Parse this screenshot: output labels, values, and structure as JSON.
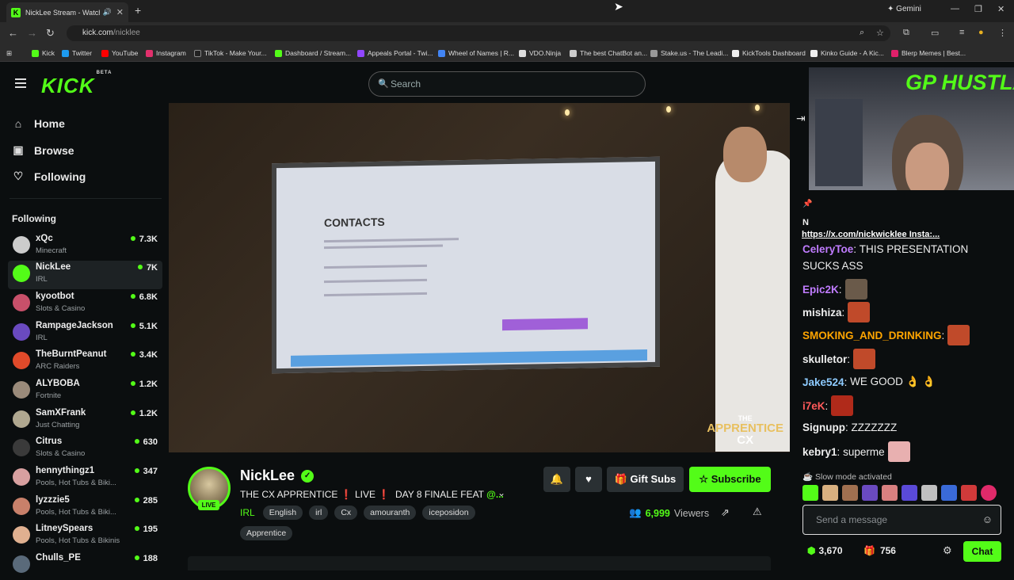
{
  "browser": {
    "tab_title": "NickLee Stream - Watch Live",
    "url_host": "kick.com",
    "url_path": "/nicklee",
    "gemini_label": "Gemini",
    "bookmarks": [
      "Kick",
      "Twitter",
      "YouTube",
      "Instagram",
      "TikTok - Make Your...",
      "Dashboard / Stream...",
      "Appeals Portal - Twi...",
      "Wheel of Names | R...",
      "VDO.Ninja",
      "The best ChatBot an...",
      "Stake.us - The Leadi...",
      "KickTools Dashboard",
      "Kinko Guide - A Kic...",
      "Blerp Memes | Best..."
    ]
  },
  "header": {
    "logo": "KICK",
    "logo_badge": "BETA",
    "search_placeholder": "Search"
  },
  "sidebar": {
    "nav": [
      {
        "label": "Home",
        "icon": "home-icon"
      },
      {
        "label": "Browse",
        "icon": "browse-icon"
      },
      {
        "label": "Following",
        "icon": "heart-icon"
      }
    ],
    "following_heading": "Following",
    "following": [
      {
        "name": "xQc",
        "category": "Minecraft",
        "viewers": "7.3K"
      },
      {
        "name": "NickLee",
        "category": "IRL",
        "viewers": "7K"
      },
      {
        "name": "kyootbot",
        "category": "Slots & Casino",
        "viewers": "6.8K"
      },
      {
        "name": "RampageJackson",
        "category": "IRL",
        "viewers": "5.1K"
      },
      {
        "name": "TheBurntPeanut",
        "category": "ARC Raiders",
        "viewers": "3.4K"
      },
      {
        "name": "ALYBOBA",
        "category": "Fortnite",
        "viewers": "1.2K"
      },
      {
        "name": "SamXFrank",
        "category": "Just Chatting",
        "viewers": "1.2K"
      },
      {
        "name": "Citrus",
        "category": "Slots & Casino",
        "viewers": "630"
      },
      {
        "name": "hennythingz1",
        "category": "Pools, Hot Tubs & Biki...",
        "viewers": "347"
      },
      {
        "name": "lyzzzie5",
        "category": "Pools, Hot Tubs & Biki...",
        "viewers": "285"
      },
      {
        "name": "LitneySpears",
        "category": "Pools, Hot Tubs & Bikinis",
        "viewers": "195"
      },
      {
        "name": "Chulls_PE",
        "category": "",
        "viewers": "188"
      }
    ]
  },
  "video": {
    "screen_heading": "CONTACTS",
    "watermark_top": "THE",
    "watermark_mid": "APPRENTICE",
    "watermark_bot": "CX"
  },
  "overlay": {
    "pip_text": "GP HUSTLA"
  },
  "stream": {
    "streamer": "NickLee",
    "live_badge": "LIVE",
    "title_part1": "THE CX APPRENTICE",
    "title_part2": "LIVE",
    "title_part3": "DAY 8 FINALE FEAT",
    "title_part4": "@...",
    "category": "IRL",
    "tags": [
      "English",
      "irl",
      "Cx",
      "amouranth",
      "iceposidon"
    ],
    "tags_row2": [
      "Apprentice"
    ],
    "viewers_count": "6,999",
    "viewers_label": "Viewers",
    "gift_subs": "Gift Subs",
    "subscribe": "Subscribe"
  },
  "chat": {
    "pinned_prefix": "N",
    "pinned_link": "https://x.com/nickwicklee Insta:...",
    "messages": [
      {
        "user": "CeleryToe",
        "text": "THIS PRESENTATION",
        "color": "#c07cff"
      },
      {
        "user": "",
        "text": "SUCKS ASS",
        "color": "#eee"
      },
      {
        "user": "Epic2K",
        "text": "",
        "color": "#c07cff"
      },
      {
        "user": "mishiza",
        "text": "",
        "color": "#eee"
      },
      {
        "user": "SMOKING_AND_DRINKING",
        "text": "",
        "color": "#ffa500"
      },
      {
        "user": "skulletor",
        "text": "",
        "color": "#eee"
      },
      {
        "user": "Jake524",
        "text": "WE GOOD 👌 👌",
        "color": "#8ecbff"
      },
      {
        "user": "i7eK",
        "text": "",
        "color": "#ff5a5a"
      },
      {
        "user": "Signupp",
        "text": "ZZZZZZZ",
        "color": "#eee"
      },
      {
        "user": "kebry1",
        "text": "superme",
        "color": "#eee"
      }
    ],
    "slow_mode": "Slow mode activated",
    "input_placeholder": "Send a message",
    "points": "3,670",
    "gift_count": "756",
    "chat_button": "Chat"
  }
}
